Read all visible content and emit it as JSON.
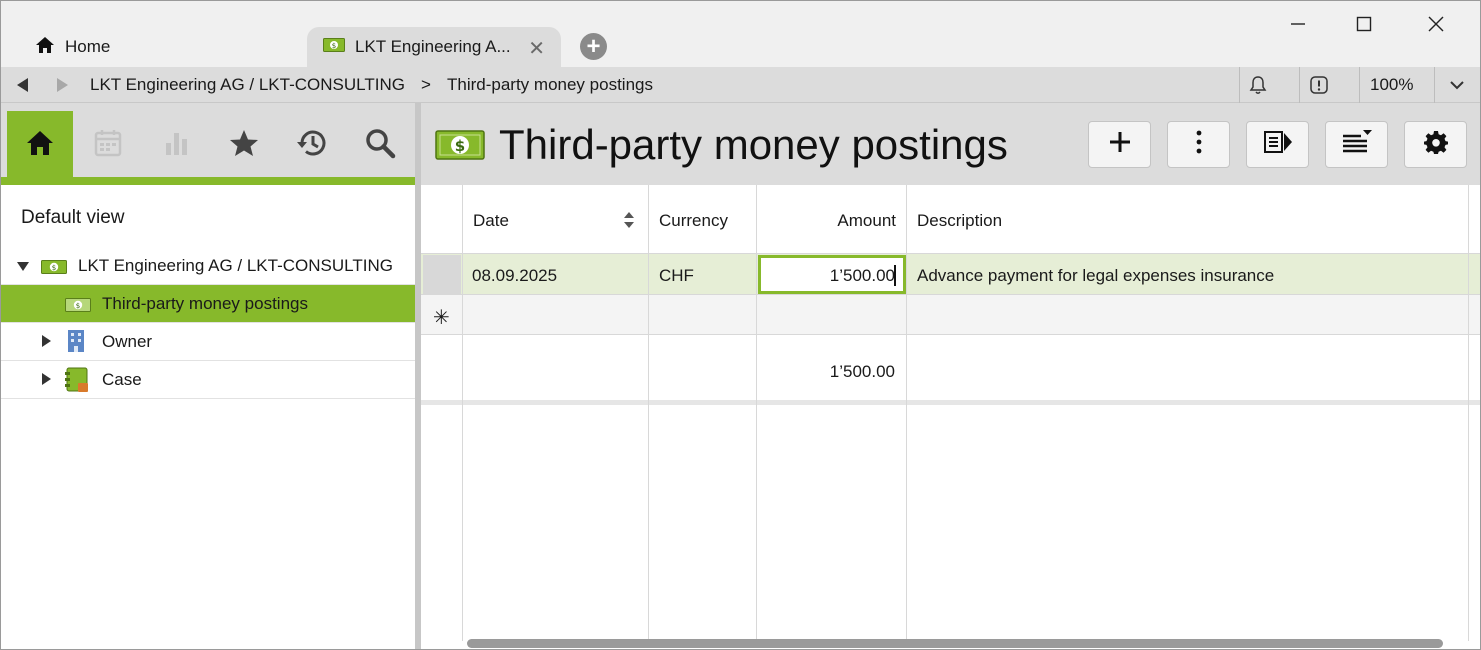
{
  "tabs": {
    "home_label": "Home",
    "active_label": "LKT Engineering A...",
    "close_glyph": "✕",
    "add_glyph": "+"
  },
  "breadcrumb": {
    "parent": "LKT Engineering AG / LKT-CONSULTING",
    "separator": ">",
    "current": "Third-party money postings"
  },
  "toolbar": {
    "zoom": "100%"
  },
  "sidebar": {
    "default_view": "Default view",
    "tree": [
      {
        "label": "LKT Engineering AG / LKT-CONSULTING",
        "icon": "money-icon",
        "expanded": true
      },
      {
        "label": "Third-party money postings",
        "icon": "money-icon",
        "selected": true
      },
      {
        "label": "Owner",
        "icon": "building-icon",
        "expanded": false
      },
      {
        "label": "Case",
        "icon": "binder-icon",
        "expanded": false
      }
    ]
  },
  "page": {
    "title": "Third-party money postings"
  },
  "table": {
    "columns": [
      "Date",
      "Currency",
      "Amount",
      "Description"
    ],
    "rows": [
      {
        "date": "08.09.2025",
        "currency": "CHF",
        "amount": "1’500.00",
        "description": "Advance payment for legal expenses insurance"
      }
    ],
    "new_row_marker": "✳",
    "total_amount": "1’500.00"
  },
  "colors": {
    "accent": "#87b92b",
    "selected_row": "#e6eed6",
    "header_bg": "#dcdcdc"
  }
}
